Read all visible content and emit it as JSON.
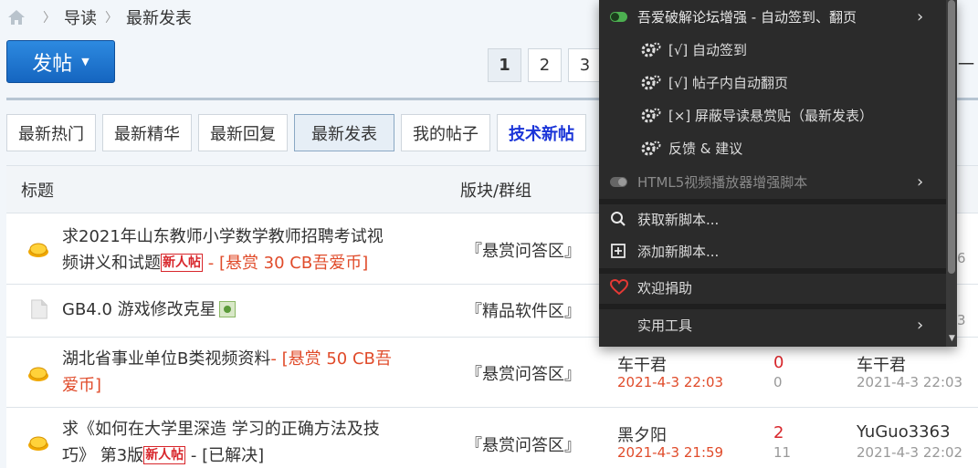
{
  "breadcrumb": {
    "items": [
      "导读",
      "最新发表"
    ]
  },
  "post_button": {
    "label": "发帖"
  },
  "pager": {
    "pages": [
      "1",
      "2",
      "3"
    ],
    "current": "1",
    "more": "一"
  },
  "tabs": [
    "最新热门",
    "最新精华",
    "最新回复",
    "最新发表",
    "我的帖子",
    "技术新帖"
  ],
  "table": {
    "headers": {
      "title": "标题",
      "forum": "版块/群组"
    },
    "rows": [
      {
        "title_line1": "求2021年山东教师小学数学教师招聘考试视",
        "title_line2": "频讲义和试题",
        "badge": "新人帖",
        "reward": " - [悬赏 30 CB吾爱币]",
        "forum": "『悬赏问答区』",
        "partial": "6"
      },
      {
        "title_line1": "GB4.0 游戏修改克星",
        "forum": "『精品软件区』",
        "partial": "3"
      },
      {
        "title_line1": "湖北省事业单位B类视频资料",
        "reward_line1": "- [悬赏 50 CB吾",
        "reward_line2": "爱币]",
        "forum": "『悬赏问答区』",
        "author": "车干君",
        "author_date": "2021-4-3 22:03",
        "replies": "0",
        "views": "0",
        "last_user": "车干君",
        "last_date": "2021-4-3 22:03"
      },
      {
        "title_line1": "求《如何在大学里深造 学习的正确方法及技",
        "title_line2": "巧》 第3版",
        "badge": "新人帖",
        "solved": " - [已解决]",
        "forum": "『悬赏问答区』",
        "author": "黑夕阳",
        "author_date": "2021-4-3 21:59",
        "replies": "2",
        "views": "11",
        "last_user": "YuGuo3363",
        "last_date": "2021-4-3 22:02"
      }
    ]
  },
  "menu": {
    "script1": {
      "label": "吾爱破解论坛增强 - 自动签到、翻页",
      "enabled": true
    },
    "sub": [
      "[√] 自动签到",
      "[√] 帖子内自动翻页",
      "[×] 屏蔽导读悬赏贴（最新发表）",
      "反馈 & 建议"
    ],
    "script2": {
      "label": "HTML5视频播放器增强脚本",
      "enabled": false
    },
    "get_scripts": "获取新脚本...",
    "add_script": "添加新脚本...",
    "donate": "欢迎捐助",
    "tools": "实用工具"
  },
  "colors": {
    "menu_bg": "#2b2b2b",
    "toggle_on": "#4caf50",
    "accent_blue": "#1a34d8",
    "reward_red": "#e04b2a"
  }
}
